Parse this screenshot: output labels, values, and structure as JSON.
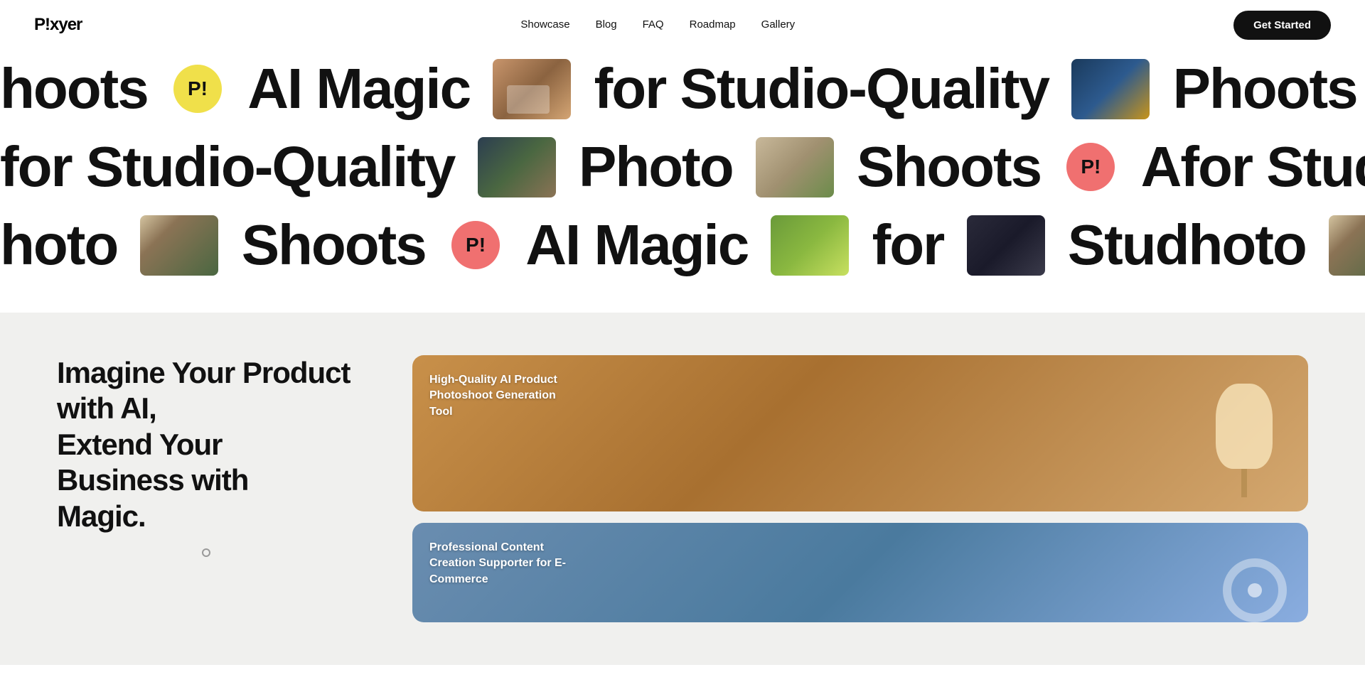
{
  "brand": {
    "name": "P!xyer",
    "logo_text": "P!xyer"
  },
  "nav": {
    "links": [
      {
        "label": "Showcase",
        "href": "#"
      },
      {
        "label": "Blog",
        "href": "#"
      },
      {
        "label": "FAQ",
        "href": "#"
      },
      {
        "label": "Roadmap",
        "href": "#"
      },
      {
        "label": "Gallery",
        "href": "#"
      }
    ],
    "cta": "Get Started"
  },
  "marquee": {
    "row1_texts": [
      "hoots",
      "AI Magic",
      "for Studio-Quality",
      "P"
    ],
    "row2_texts": [
      "for Studio-Quality",
      "Photo",
      "Shoots",
      "A"
    ],
    "row3_texts": [
      "hoto",
      "Shoots",
      "AI Magic",
      "for",
      "Stud"
    ],
    "badge_label": "P!"
  },
  "hero": {
    "heading_line1": "Imagine Your Product with AI,",
    "heading_line2": "Extend Your Business with",
    "heading_line3": "Magic."
  },
  "cards": [
    {
      "id": "card-lamp",
      "title": "High-Quality AI Product Photoshoot Generation Tool"
    },
    {
      "id": "card-fan",
      "title": "Professional Content Creation Supporter for E-Commerce"
    }
  ]
}
